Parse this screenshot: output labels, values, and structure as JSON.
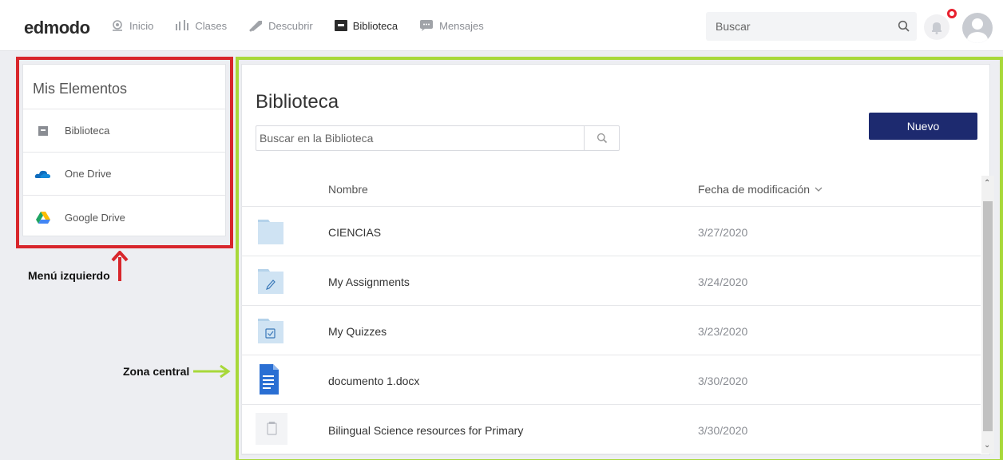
{
  "header": {
    "logo": "edmodo",
    "nav": [
      {
        "label": "Inicio",
        "icon": "home-icon"
      },
      {
        "label": "Clases",
        "icon": "classes-icon"
      },
      {
        "label": "Descubrir",
        "icon": "discover-icon"
      },
      {
        "label": "Biblioteca",
        "icon": "library-icon",
        "active": true
      },
      {
        "label": "Mensajes",
        "icon": "messages-icon"
      }
    ],
    "search_placeholder": "Buscar",
    "notification_color": "#e8212f"
  },
  "sidebar": {
    "title": "Mis Elementos",
    "items": [
      {
        "label": "Biblioteca",
        "icon": "library-icon"
      },
      {
        "label": "One Drive",
        "icon": "onedrive-icon"
      },
      {
        "label": "Google Drive",
        "icon": "google-drive-icon"
      }
    ]
  },
  "annotations": {
    "menu_label": "Menú izquierdo",
    "zone_label": "Zona central",
    "menu_color": "#d8262c",
    "zone_color": "#a8d83a"
  },
  "main": {
    "title": "Biblioteca",
    "search_placeholder": "Buscar en la Biblioteca",
    "new_button": "Nuevo",
    "columns": {
      "name": "Nombre",
      "date": "Fecha de modificación"
    },
    "rows": [
      {
        "name": "CIENCIAS",
        "date": "3/27/2020",
        "icon": "folder-icon"
      },
      {
        "name": "My Assignments",
        "date": "3/24/2020",
        "icon": "assignments-folder-icon"
      },
      {
        "name": "My Quizzes",
        "date": "3/23/2020",
        "icon": "quizzes-folder-icon"
      },
      {
        "name": "documento 1.docx",
        "date": "3/30/2020",
        "icon": "document-icon"
      },
      {
        "name": "Bilingual Science resources for Primary",
        "date": "3/30/2020",
        "icon": "resource-file-icon"
      }
    ]
  }
}
